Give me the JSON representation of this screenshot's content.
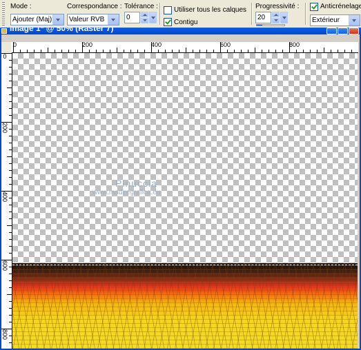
{
  "toolbar": {
    "mode_label": "Mode :",
    "mode_value": "Ajouter (Maj)",
    "match_label": "Correspondance :",
    "match_value": "Valeur RVB",
    "tolerance_label": "Tolérance :",
    "tolerance_value": "0",
    "all_layers_label": "Utiliser tous les calques",
    "all_layers_checked": false,
    "contiguous_label": "Contigu",
    "contiguous_checked": true,
    "feather_label": "Progressivité :",
    "feather_value": "20",
    "antialias_label": "Anticrénelage",
    "antialias_checked": true,
    "antialias_value": "Extérieur"
  },
  "document": {
    "title": "Image 1* @ 50% (Raster 7)"
  },
  "ruler": {
    "h_labels": [
      "0",
      "200",
      "400",
      "600",
      "800"
    ],
    "v_labels": [
      "0",
      "200",
      "400",
      "600",
      "800"
    ]
  },
  "watermark": {
    "line1": "Pinuccia",
    "line2": "www.madiregrafica.eu"
  },
  "colors": {
    "title_bar": "#0a5ee8",
    "checker_dark": "#c0c0c0",
    "floor_top": "#1a0e05",
    "floor_red": "#e0341a",
    "floor_yellow": "#f5d421"
  }
}
